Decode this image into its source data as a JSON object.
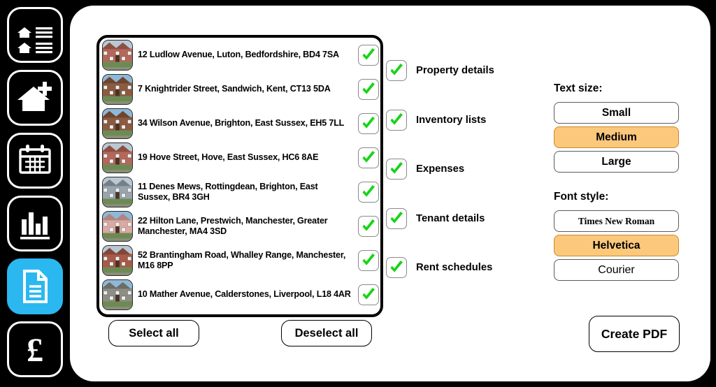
{
  "sidebar": {
    "items": [
      {
        "id": "properties",
        "icon": "houses-list-icon",
        "active": false
      },
      {
        "id": "add-property",
        "icon": "house-plus-icon",
        "active": false
      },
      {
        "id": "calendar",
        "icon": "calendar-icon",
        "active": false
      },
      {
        "id": "reports",
        "icon": "bar-chart-icon",
        "active": false
      },
      {
        "id": "documents",
        "icon": "document-icon",
        "active": true
      },
      {
        "id": "finances",
        "icon": "pound-sterling-icon",
        "active": false
      }
    ],
    "active_color": "#2BB8F0"
  },
  "property_list": {
    "items": [
      {
        "address": "12 Ludlow Avenue, Luton, Bedfordshire, BD4 7SA",
        "checked": true,
        "thumb": "brick-terrace-photo"
      },
      {
        "address": "7 Knightrider Street, Sandwich, Kent, CT13 5DA",
        "checked": true,
        "thumb": "grey-semi-photo"
      },
      {
        "address": "34 Wilson Avenue, Brighton, East Sussex, EH5 7LL",
        "checked": true,
        "thumb": "red-brick-bungalow-photo"
      },
      {
        "address": "19 Hove Street, Hove, East Sussex, HC6 8AE",
        "checked": true,
        "thumb": "white-cottage-photo"
      },
      {
        "address": "11 Denes Mews, Rottingdean, Brighton, East Sussex, BR4 3GH",
        "checked": true,
        "thumb": "pink-house-photo"
      },
      {
        "address": "22 Hilton Lane, Prestwich, Manchester, Greater Manchester, MA4 3SD",
        "checked": true,
        "thumb": "victorian-house-photo"
      },
      {
        "address": "52 Brantingham Road, Whalley Range, Manchester, M16 8PP",
        "checked": true,
        "thumb": "brick-detached-photo"
      },
      {
        "address": "10 Mather Avenue, Calderstones, Liverpool, L18 4AR",
        "checked": true,
        "thumb": "stone-terrace-photo"
      }
    ],
    "select_all_label": "Select all",
    "deselect_all_label": "Deselect all"
  },
  "options": {
    "items": [
      {
        "label": "Property details",
        "checked": true
      },
      {
        "label": "Inventory lists",
        "checked": true
      },
      {
        "label": "Expenses",
        "checked": true
      },
      {
        "label": "Tenant details",
        "checked": true
      },
      {
        "label": "Rent schedules",
        "checked": true
      }
    ]
  },
  "settings": {
    "text_size": {
      "title": "Text size:",
      "options": [
        {
          "label": "Small",
          "selected": false
        },
        {
          "label": "Medium",
          "selected": true
        },
        {
          "label": "Large",
          "selected": false
        }
      ]
    },
    "font_style": {
      "title": "Font style:",
      "options": [
        {
          "label": "Times New Roman",
          "selected": false,
          "style": "serif"
        },
        {
          "label": "Helvetica",
          "selected": true,
          "style": "sans"
        },
        {
          "label": "Courier",
          "selected": false,
          "style": "mono"
        }
      ]
    },
    "create_pdf_label": "Create PDF",
    "highlight_color": "#FBC87C"
  }
}
